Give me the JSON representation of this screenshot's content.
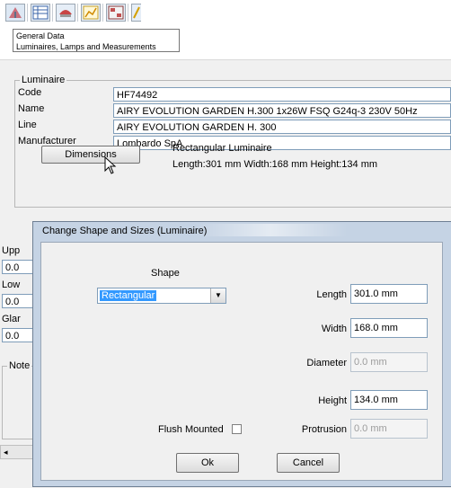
{
  "toolbar": {
    "icons": [
      "general-data-icon",
      "table-icon",
      "lamp-icon",
      "chart-icon",
      "grid-icon",
      "extra-icon"
    ],
    "tooltip": {
      "line1": "General Data",
      "line2": "Luminaires, Lamps and Measurements"
    }
  },
  "luminaire": {
    "group_title": "Luminaire",
    "code_label": "Code",
    "code_value": "HF74492",
    "name_label": "Name",
    "name_value": "AIRY EVOLUTION GARDEN H.300 1x26W FSQ G24q-3 230V 50Hz",
    "line_label": "Line",
    "line_value": "AIRY EVOLUTION GARDEN H. 300",
    "manufacturer_label": "Manufacturer",
    "manufacturer_value": "Lombardo SpA",
    "dimensions_button": "Dimensions",
    "shape_text": "Rectangular Luminaire",
    "size_text": "Length:301 mm  Width:168 mm  Height:134 mm"
  },
  "background_fragments": {
    "upper_label": "Upp",
    "upper_value": "0.0",
    "lower_label": "Low",
    "lower_value": "0.0",
    "glare_label": "Glar",
    "glare_value": "0.0",
    "notes_title": "Note",
    "scroll_arrow": "◂"
  },
  "dialog": {
    "title": "Change Shape and Sizes (Luminaire)",
    "shape_label": "Shape",
    "shape_value": "Rectangular",
    "length_label": "Length",
    "length_value": "301.0 mm",
    "width_label": "Width",
    "width_value": "168.0 mm",
    "diameter_label": "Diameter",
    "diameter_value": "0.0 mm",
    "height_label": "Height",
    "height_value": "134.0 mm",
    "protrusion_label": "Protrusion",
    "protrusion_value": "0.0 mm",
    "flush_label": "Flush Mounted",
    "flush_checked": false,
    "ok_label": "Ok",
    "cancel_label": "Cancel"
  }
}
